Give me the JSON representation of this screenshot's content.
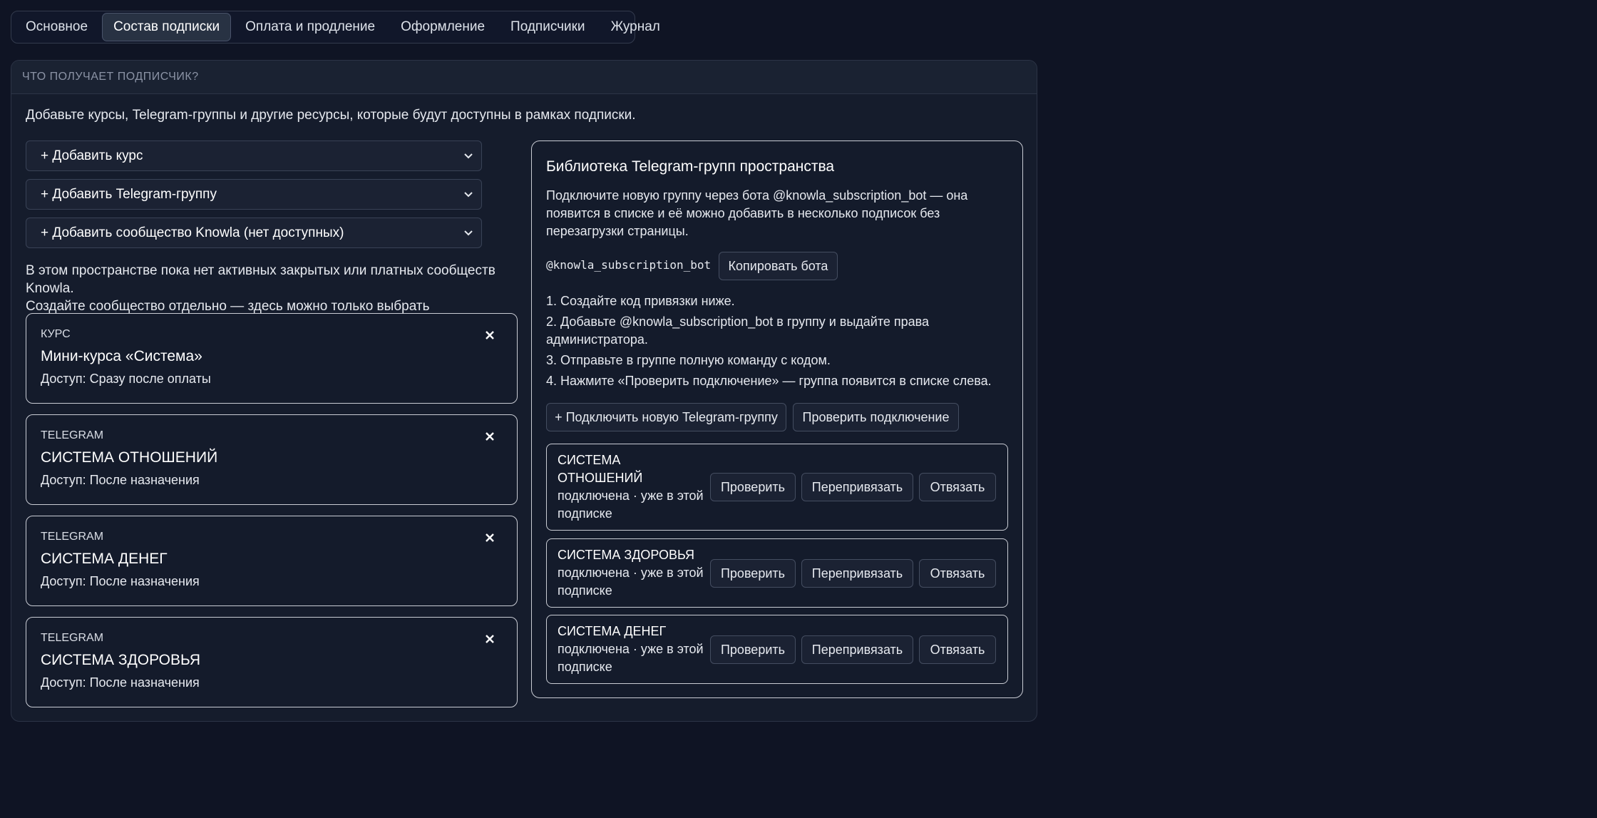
{
  "tabs": [
    {
      "label": "Основное",
      "active": false
    },
    {
      "label": "Состав подписки",
      "active": true
    },
    {
      "label": "Оплата и продление",
      "active": false
    },
    {
      "label": "Оформление",
      "active": false
    },
    {
      "label": "Подписчики",
      "active": false
    },
    {
      "label": "Журнал",
      "active": false
    }
  ],
  "panel": {
    "heading": "ЧТО ПОЛУЧАЕТ ПОДПИСЧИК?",
    "intro": "Добавьте курсы, Telegram-группы и другие ресурсы, которые будут доступны в рамках подписки.",
    "selects": [
      "+ Добавить курс",
      "+ Добавить Telegram-группу",
      "+ Добавить сообщество Knowla (нет доступных)"
    ],
    "note_lines": [
      "В этом пространстве пока нет активных закрытых или платных сообществ Knowla.",
      "Создайте сообщество отдельно — здесь можно только выбрать существующее."
    ],
    "items": [
      {
        "kind": "КУРС",
        "title": "Мини-курса «Система»",
        "access": "Доступ: Сразу после оплаты"
      },
      {
        "kind": "TELEGRAM",
        "title": "СИСТЕМА ОТНОШЕНИЙ",
        "access": "Доступ: После назначения"
      },
      {
        "kind": "TELEGRAM",
        "title": "СИСТЕМА ДЕНЕГ",
        "access": "Доступ: После назначения"
      },
      {
        "kind": "TELEGRAM",
        "title": "СИСТЕМА ЗДОРОВЬЯ",
        "access": "Доступ: После назначения"
      }
    ]
  },
  "library": {
    "title": "Библиотека Telegram-групп пространства",
    "desc_lines": [
      "Подключите новую группу через бота @knowla_subscription_bot — она",
      "появится в списке и её можно добавить в несколько подписок без",
      "перезагрузки страницы."
    ],
    "bot_handle": "@knowla_subscription_bot",
    "copy_label": "Копировать бота",
    "steps": [
      "1. Создайте код привязки ниже.",
      "2. Добавьте @knowla_subscription_bot в группу и выдайте права",
      "администратора.",
      "3. Отправьте в группе полную команду с кодом.",
      "4. Нажмите «Проверить подключение» — группа появится в списке слева."
    ],
    "connect_label": "+ Подключить новую Telegram-группу",
    "check_conn_label": "Проверить подключение",
    "groups": [
      {
        "name_lines": [
          "СИСТЕМА",
          "ОТНОШЕНИЙ"
        ],
        "status_lines": [
          "подключена · уже в этой",
          "подписке"
        ]
      },
      {
        "name_lines": [
          "СИСТЕМА ЗДОРОВЬЯ"
        ],
        "status_lines": [
          "подключена · уже в этой",
          "подписке"
        ]
      },
      {
        "name_lines": [
          "СИСТЕМА ДЕНЕГ"
        ],
        "status_lines": [
          "подключена · уже в этой",
          "подписке"
        ]
      }
    ],
    "group_actions": {
      "check": "Проверить",
      "rebind": "Перепривязать",
      "unbind": "Отвязать"
    }
  }
}
